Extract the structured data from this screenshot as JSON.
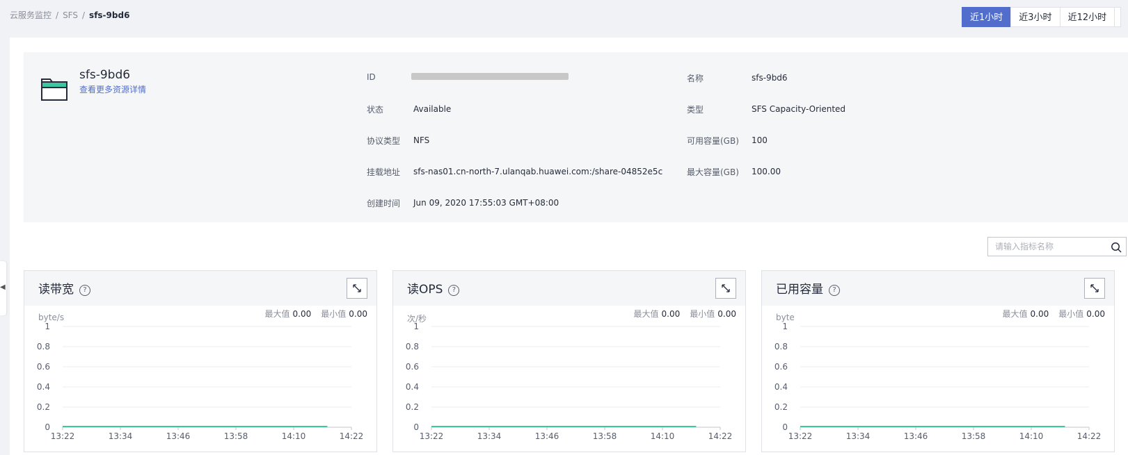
{
  "breadcrumb": [
    "云服务监控",
    "SFS",
    "sfs-9bd6"
  ],
  "time_range": {
    "options": [
      "近1小时",
      "近3小时",
      "近12小时"
    ],
    "selected": "近1小时"
  },
  "resource": {
    "name": "sfs-9bd6",
    "details_link": "查看更多资源详情",
    "icon": "folder-icon",
    "icon_color": "#3ec6a0"
  },
  "info": {
    "id_label": "ID",
    "status_label": "状态",
    "status_value": "Available",
    "protocol_label": "协议类型",
    "protocol_value": "NFS",
    "mount_label": "挂载地址",
    "mount_value": "sfs-nas01.cn-north-7.ulanqab.huawei.com:/share-04852e5c",
    "created_label": "创建时间",
    "created_value": "Jun 09, 2020 17:55:03 GMT+08:00",
    "name_label": "名称",
    "name_value": "sfs-9bd6",
    "type_label": "类型",
    "type_value": "SFS Capacity-Oriented",
    "avail_label": "可用容量(GB)",
    "avail_value": "100",
    "max_label": "最大容量(GB)",
    "max_value": "100.00"
  },
  "search": {
    "placeholder": "请输入指标名称"
  },
  "colors": {
    "accent": "#526ecc",
    "line": "#3ec6a0"
  },
  "metrics": [
    {
      "title": "读带宽",
      "unit": "byte/s",
      "max_label": "最大值",
      "max": "0.00",
      "min_label": "最小值",
      "min": "0.00"
    },
    {
      "title": "读OPS",
      "unit": "次/秒",
      "max_label": "最大值",
      "max": "0.00",
      "min_label": "最小值",
      "min": "0.00"
    },
    {
      "title": "已用容量",
      "unit": "byte",
      "max_label": "最大值",
      "max": "0.00",
      "min_label": "最小值",
      "min": "0.00"
    }
  ],
  "chart_data": [
    {
      "type": "line",
      "title": "读带宽",
      "ylabel": "byte/s",
      "ylim": [
        0,
        1
      ],
      "yticks": [
        "0",
        "0.2",
        "0.4",
        "0.6",
        "0.8",
        "1"
      ],
      "xticks": [
        "13:22",
        "13:34",
        "13:46",
        "13:58",
        "14:10",
        "14:22"
      ],
      "series": [
        {
          "x": [
            "13:22",
            "14:17"
          ],
          "values": [
            0,
            0
          ]
        }
      ]
    },
    {
      "type": "line",
      "title": "读OPS",
      "ylabel": "次/秒",
      "ylim": [
        0,
        1
      ],
      "yticks": [
        "0",
        "0.2",
        "0.4",
        "0.6",
        "0.8",
        "1"
      ],
      "xticks": [
        "13:22",
        "13:34",
        "13:46",
        "13:58",
        "14:10",
        "14:22"
      ],
      "series": [
        {
          "x": [
            "13:22",
            "14:17"
          ],
          "values": [
            0,
            0
          ]
        }
      ]
    },
    {
      "type": "line",
      "title": "已用容量",
      "ylabel": "byte",
      "ylim": [
        0,
        1
      ],
      "yticks": [
        "0",
        "0.2",
        "0.4",
        "0.6",
        "0.8",
        "1"
      ],
      "xticks": [
        "13:22",
        "13:34",
        "13:46",
        "13:58",
        "14:10",
        "14:22"
      ],
      "series": [
        {
          "x": [
            "13:22",
            "14:17"
          ],
          "values": [
            0,
            0
          ]
        }
      ]
    }
  ]
}
